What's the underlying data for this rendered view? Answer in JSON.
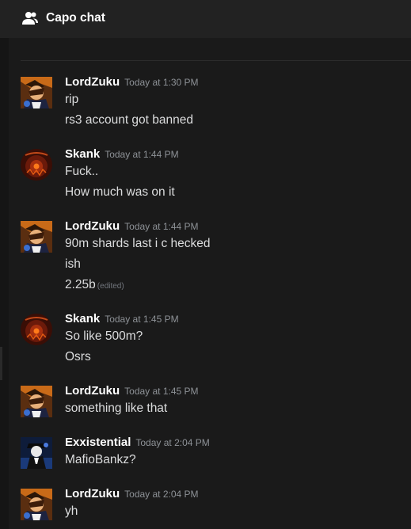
{
  "header": {
    "title": "Capo chat",
    "icon": "people-icon"
  },
  "messages": [
    {
      "author": "LordZuku",
      "time": "Today at 1:30 PM",
      "avatar": "lordzuku-avatar",
      "lines": [
        {
          "text": "rip"
        },
        {
          "text": "rs3 account got banned"
        }
      ]
    },
    {
      "author": "Skank",
      "time": "Today at 1:44 PM",
      "avatar": "skank-avatar",
      "lines": [
        {
          "text": "Fuck.."
        },
        {
          "text": "How much was on it"
        }
      ]
    },
    {
      "author": "LordZuku",
      "time": "Today at 1:44 PM",
      "avatar": "lordzuku-avatar",
      "lines": [
        {
          "text": "90m shards last i c hecked"
        },
        {
          "text": "ish"
        },
        {
          "text": "2.25b",
          "edited": "(edited)"
        }
      ]
    },
    {
      "author": "Skank",
      "time": "Today at 1:45 PM",
      "avatar": "skank-avatar",
      "lines": [
        {
          "text": "So like 500m?"
        },
        {
          "text": "Osrs"
        }
      ]
    },
    {
      "author": "LordZuku",
      "time": "Today at 1:45 PM",
      "avatar": "lordzuku-avatar",
      "lines": [
        {
          "text": "something like that"
        }
      ]
    },
    {
      "author": "Exxistential",
      "time": "Today at 2:04 PM",
      "avatar": "exxistential-avatar",
      "lines": [
        {
          "text": "MafioBankz?"
        }
      ]
    },
    {
      "author": "LordZuku",
      "time": "Today at 2:04 PM",
      "avatar": "lordzuku-avatar",
      "lines": [
        {
          "text": "yh"
        }
      ]
    }
  ],
  "colors": {
    "background": "#1a1a1a",
    "header": "#222222",
    "author": "#ffffff",
    "timestamp": "#8e9297",
    "message": "#dcddde"
  }
}
